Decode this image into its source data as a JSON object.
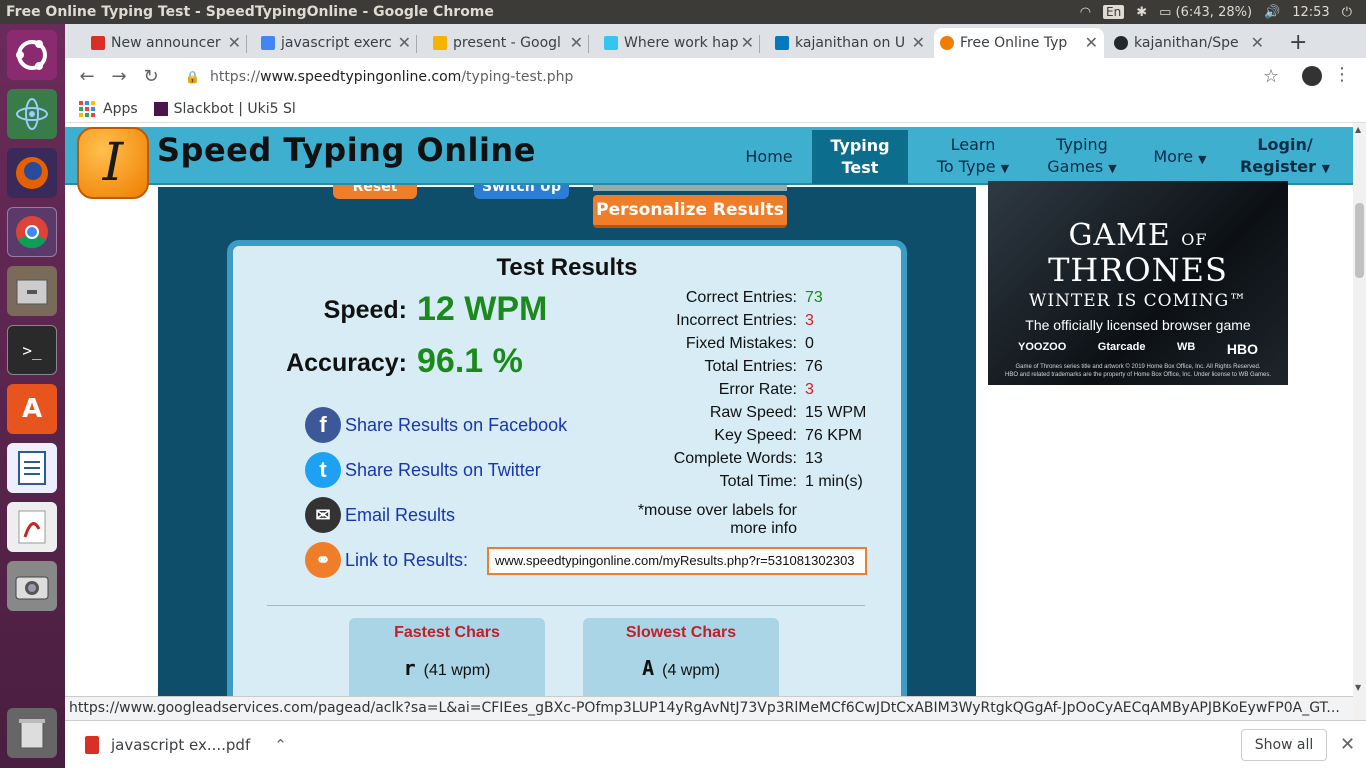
{
  "os": {
    "window_title": "Free Online Typing Test - SpeedTypingOnline - Google Chrome",
    "lang": "En",
    "battery": "(6:43, 28%)",
    "clock": "12:53"
  },
  "tabs": [
    {
      "label": "New announcer",
      "color": "#d93025"
    },
    {
      "label": "javascript exerc",
      "color": "#4285f4"
    },
    {
      "label": "present - Googl",
      "color": "#f4b400"
    },
    {
      "label": "Where work hap",
      "color": "#36c5f0"
    },
    {
      "label": "kajanithan on U",
      "color": "#0079bf"
    },
    {
      "label": "Free Online Typ",
      "color": "#f07d00"
    },
    {
      "label": "kajanithan/Spe",
      "color": "#24292e"
    }
  ],
  "toolbar": {
    "url_scheme": "https://",
    "url_host": "www.speedtypingonline.com",
    "url_path": "/typing-test.php"
  },
  "bookmarks": {
    "apps": "Apps",
    "slackbot": "Slackbot | Uki5 Sl"
  },
  "site": {
    "logo_letter": "I",
    "name": "Speed Typing Online",
    "nav": {
      "home": "Home",
      "typing_test_1": "Typing",
      "typing_test_2": "Test",
      "learn_1": "Learn",
      "learn_2": "To Type",
      "games_1": "Typing",
      "games_2": "Games",
      "more": "More",
      "login_1": "Login/",
      "login_2": "Register"
    },
    "top_buttons": {
      "reset": "Reset",
      "switch_up": "Switch Up",
      "personalize": "Personalize Results"
    }
  },
  "results": {
    "title": "Test Results",
    "speed_label": "Speed:",
    "speed_value": "12 WPM",
    "accuracy_label": "Accuracy:",
    "accuracy_value": "96.1 %",
    "stats": [
      {
        "label": "Correct Entries:",
        "value": "73",
        "color": "#1a8a1a"
      },
      {
        "label": "Incorrect Entries:",
        "value": "3",
        "color": "#d42020"
      },
      {
        "label": "Fixed Mistakes:",
        "value": "0",
        "color": "#111111"
      },
      {
        "label": "Total Entries:",
        "value": "76",
        "color": "#111111"
      },
      {
        "label": "Error Rate:",
        "value": "3",
        "color": "#d42020"
      },
      {
        "label": "Raw Speed:",
        "value": "15 WPM",
        "color": "#111111"
      },
      {
        "label": "Key Speed:",
        "value": "76 KPM",
        "color": "#111111"
      },
      {
        "label": "Complete Words:",
        "value": "13",
        "color": "#111111"
      },
      {
        "label": "Total Time:",
        "value": "1 min(s)",
        "color": "#111111"
      }
    ],
    "hint_1": "*mouse over labels for",
    "hint_2": "more info",
    "share_facebook": "Share Results on Facebook",
    "share_twitter": "Share Results on Twitter",
    "email": "Email Results",
    "link_label": "Link to Results:",
    "link_value": "www.speedtypingonline.com/myResults.php?r=531081302303",
    "fastest_title": "Fastest Chars",
    "fastest_char": "r",
    "fastest_speed": "(41 wpm)",
    "slowest_title": "Slowest Chars",
    "slowest_char": "A",
    "slowest_speed": "(4 wpm)"
  },
  "ad": {
    "game_title_1": "GAME",
    "game_title_of": "OF",
    "game_title_2": "THRONES",
    "tagline": "WINTER IS COMING™",
    "subtitle": "The officially licensed browser game",
    "brands": [
      "YOOZOO",
      "Gtarcade",
      "WB",
      "HBO"
    ],
    "legal_1": "Game of Thrones series title and artwork © 2019 Home Box Office, Inc. All Rights Reserved.",
    "legal_2": "HBO and related trademarks are the property of Home Box Office, Inc. Under license to WB Games."
  },
  "status_url": "https://www.googleadservices.com/pagead/aclk?sa=L&ai=CFIEes_gBXc-POfmp3LUP14yRgAvNtJ73Vp3RlMeMCf6CwJDtCxABIM3WyRtgkQGgAf-JpOoCyAECqAMByAPJBKoEywFP0A_GT...",
  "downloads": {
    "file": "javascript ex....pdf",
    "show_all": "Show all"
  }
}
